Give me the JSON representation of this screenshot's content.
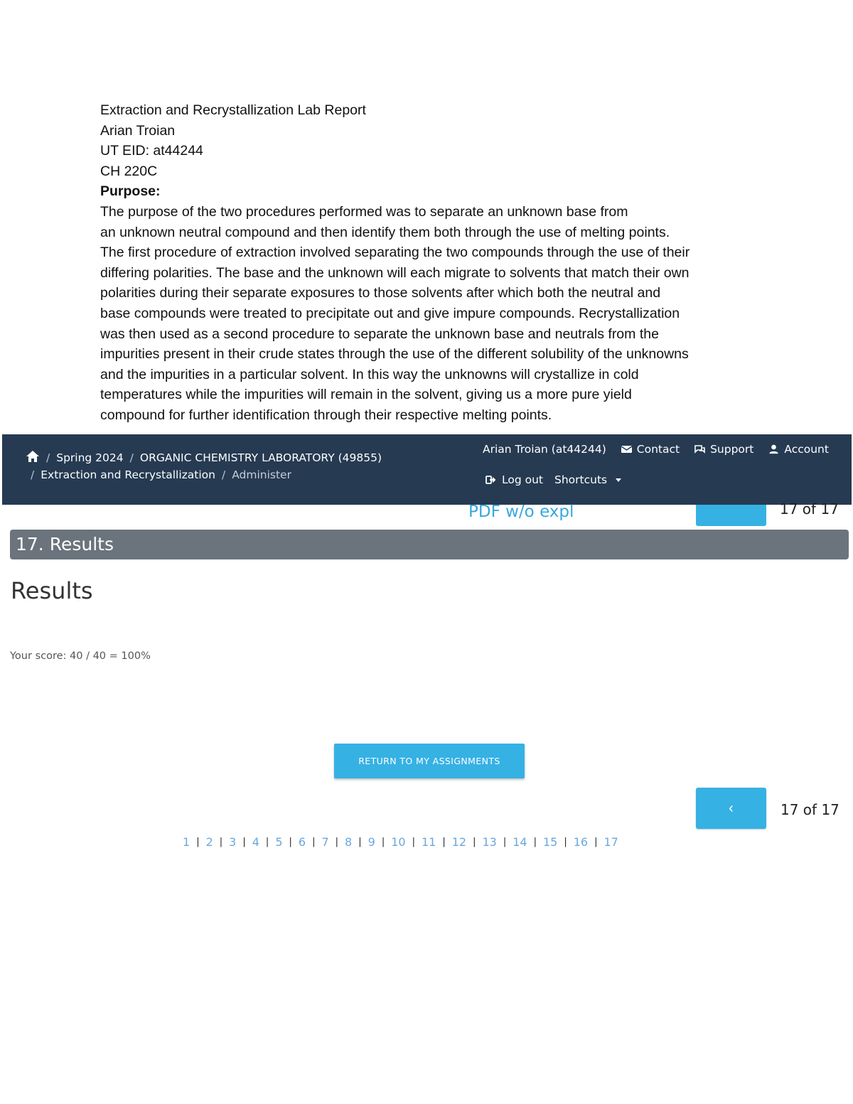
{
  "document": {
    "title": "Extraction and Recrystallization Lab Report",
    "author": "Arian Troian",
    "eid": "UT EID: at44244",
    "course": "CH 220C",
    "purpose_label": "Purpose:",
    "purpose_lines": [
      "The purpose of the two procedures performed was to separate an unknown base from",
      "an unknown neutral compound and then identify them both through the use of melting points.",
      "The first procedure of extraction involved separating the two compounds through the use of their",
      "differing polarities. The base and the unknown will each migrate to solvents that match their own",
      "polarities during their separate exposures to those solvents after which both the neutral and",
      "base compounds were treated to precipitate out and give impure compounds. Recrystallization",
      "was then used as a second procedure to separate the unknown base and neutrals from the",
      "impurities present in their crude states through the use of the different solubility of the unknowns",
      "and the impurities in a particular solvent. In this way the unknowns will crystallize in cold",
      "temperatures while the impurities will remain in the solvent, giving us a more pure yield",
      "compound for further identification through their respective melting points."
    ]
  },
  "navbar": {
    "breadcrumb": {
      "term": "Spring 2024",
      "course": "ORGANIC CHEMISTRY LABORATORY (49855)",
      "assignment": "Extraction and Recrystallization",
      "current": "Administer"
    },
    "user": "Arian Troian (at44244)",
    "contact": "Contact",
    "support": "Support",
    "account": "Account",
    "logout": "Log out",
    "shortcuts": "Shortcuts"
  },
  "pdf_link": "PDF w/o expl",
  "section_header": "17. Results",
  "results_title": "Results",
  "score": "Your score: 40 / 40 = 100%",
  "return_button": "RETURN TO MY ASSIGNMENTS",
  "prev_icon": "‹",
  "counter": "17 of 17",
  "pages": [
    "1",
    "2",
    "3",
    "4",
    "5",
    "6",
    "7",
    "8",
    "9",
    "10",
    "11",
    "12",
    "13",
    "14",
    "15",
    "16",
    "17"
  ],
  "colors": {
    "navbar": "#263a52",
    "accent": "#36b1e4",
    "section_bar": "#6b747c",
    "link": "#6aa7dd"
  }
}
